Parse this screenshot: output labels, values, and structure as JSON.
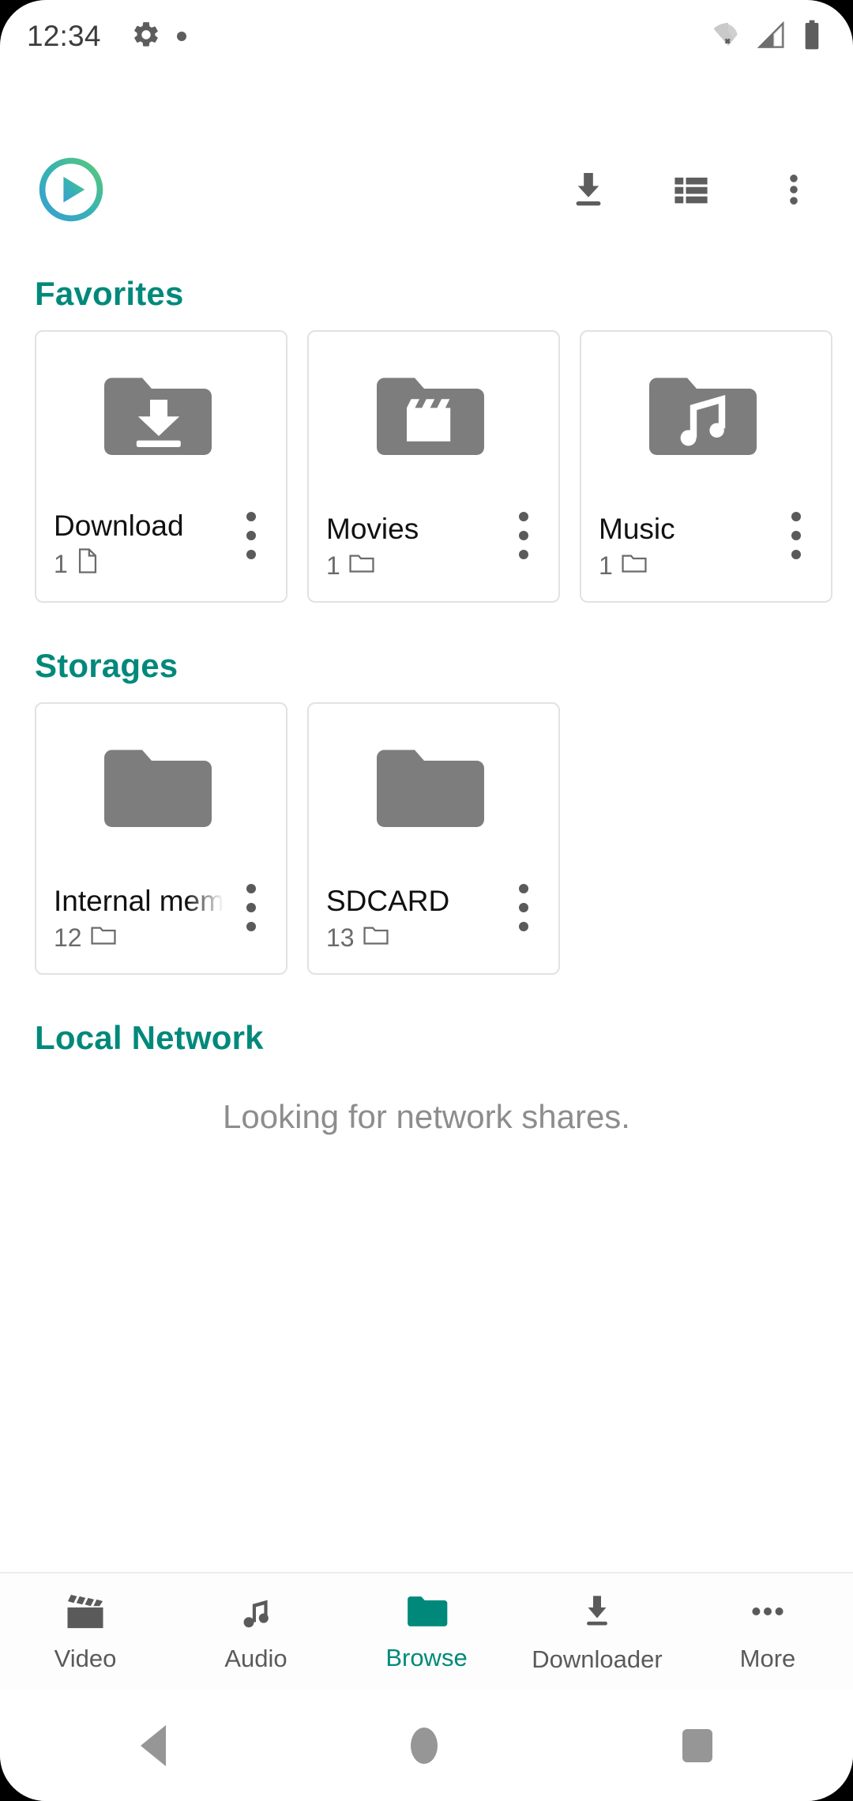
{
  "status_bar": {
    "time": "12:34",
    "icons_left": [
      "gear-icon",
      "dot-indicator"
    ],
    "icons_right": [
      "wifi-off-icon",
      "cellular-signal-icon",
      "battery-full-icon"
    ]
  },
  "toolbar": {
    "logo": "vlc-cone-play-icon",
    "actions": [
      {
        "name": "download-icon",
        "label": "Download"
      },
      {
        "name": "list-view-icon",
        "label": "Display in list"
      },
      {
        "name": "overflow-menu-icon",
        "label": "More options"
      }
    ]
  },
  "sections": [
    {
      "title": "Favorites",
      "items": [
        {
          "title": "Download",
          "count": "1",
          "count_icon": "file-icon",
          "thumb": "folder-download-icon"
        },
        {
          "title": "Movies",
          "count": "1",
          "count_icon": "folder-icon",
          "thumb": "folder-movie-icon"
        },
        {
          "title": "Music",
          "count": "1",
          "count_icon": "folder-icon",
          "thumb": "folder-music-icon"
        }
      ]
    },
    {
      "title": "Storages",
      "items": [
        {
          "title": "Internal memory",
          "count": "12",
          "count_icon": "folder-icon",
          "thumb": "folder-icon",
          "truncated": true
        },
        {
          "title": "SDCARD",
          "count": "13",
          "count_icon": "folder-icon",
          "thumb": "folder-icon",
          "truncated": false
        }
      ]
    },
    {
      "title": "Local Network",
      "message": "Looking for network shares."
    }
  ],
  "bottom_nav": [
    {
      "label": "Video",
      "icon": "clapperboard-icon",
      "active": false
    },
    {
      "label": "Audio",
      "icon": "music-note-icon",
      "active": false
    },
    {
      "label": "Browse",
      "icon": "folder-icon",
      "active": true
    },
    {
      "label": "Downloader",
      "icon": "download-icon",
      "active": false
    },
    {
      "label": "More",
      "icon": "ellipsis-icon",
      "active": false
    }
  ],
  "android_nav": [
    {
      "name": "back-button"
    },
    {
      "name": "home-button"
    },
    {
      "name": "recents-button"
    }
  ],
  "colors": {
    "accent": "#00897b",
    "icon_gray": "#757575",
    "text_primary": "#111111",
    "text_secondary": "#6b6b6b",
    "card_border": "#e2e2e2"
  }
}
